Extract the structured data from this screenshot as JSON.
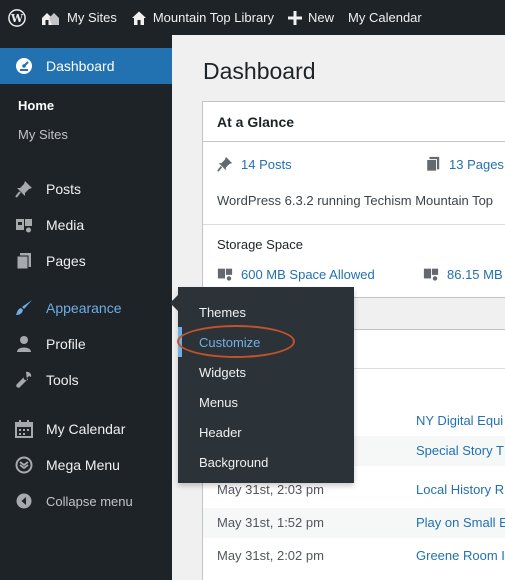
{
  "admin_bar": {
    "wp_logo_icon": "wordpress-logo-icon",
    "my_sites": "My Sites",
    "site_name": "Mountain Top Library",
    "new_label": "New",
    "calendar": "My Calendar"
  },
  "sidebar": {
    "dashboard": "Dashboard",
    "home": "Home",
    "my_sites": "My Sites",
    "posts": "Posts",
    "media": "Media",
    "pages": "Pages",
    "appearance": "Appearance",
    "profile": "Profile",
    "tools": "Tools",
    "my_calendar": "My Calendar",
    "mega_menu": "Mega Menu",
    "collapse": "Collapse menu"
  },
  "flyout": {
    "items": [
      "Themes",
      "Customize",
      "Widgets",
      "Menus",
      "Header",
      "Background"
    ],
    "active_index": 1
  },
  "main": {
    "title": "Dashboard",
    "at_a_glance": {
      "heading": "At a Glance",
      "posts": "14 Posts",
      "pages": "13 Pages",
      "version_text": "WordPress 6.3.2 running Techism Mountain Top",
      "storage_heading": "Storage Space",
      "space_allowed": "600 MB Space Allowed",
      "space_used": "86.15 MB"
    },
    "activity": [
      {
        "date": "",
        "title": "NY Digital Equi"
      },
      {
        "date": "",
        "title": "Special Story T"
      },
      {
        "date": "May 31st, 2:03 pm",
        "title": "Local History R"
      },
      {
        "date": "May 31st, 1:52 pm",
        "title": "Play on Small E"
      },
      {
        "date": "May 31st, 2:02 pm",
        "title": "Greene Room I"
      }
    ]
  },
  "colors": {
    "admin_bar_bg": "#1d2327",
    "sidebar_bg": "#1d2327",
    "accent": "#2271b1",
    "flyout_bg": "#2c3338",
    "highlight": "#c0532a"
  }
}
